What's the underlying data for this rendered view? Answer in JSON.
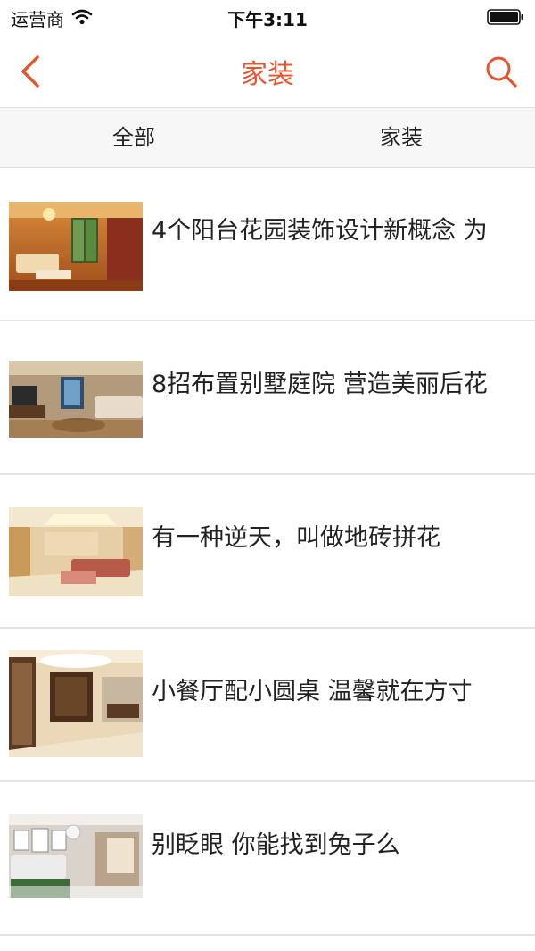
{
  "status": {
    "carrier": "运营商",
    "time": "下午3:11"
  },
  "nav": {
    "title": "家装"
  },
  "tabs": [
    {
      "label": "全部"
    },
    {
      "label": "家装"
    }
  ],
  "articles": [
    {
      "title": "4个阳台花园装饰设计新概念 为"
    },
    {
      "title": "8招布置别墅庭院 营造美丽后花"
    },
    {
      "title": "有一种逆天，叫做地砖拼花"
    },
    {
      "title": "小餐厅配小圆桌 温馨就在方寸"
    },
    {
      "title": "别眨眼 你能找到兔子么"
    }
  ],
  "colors": {
    "accent": "#e8542f"
  }
}
